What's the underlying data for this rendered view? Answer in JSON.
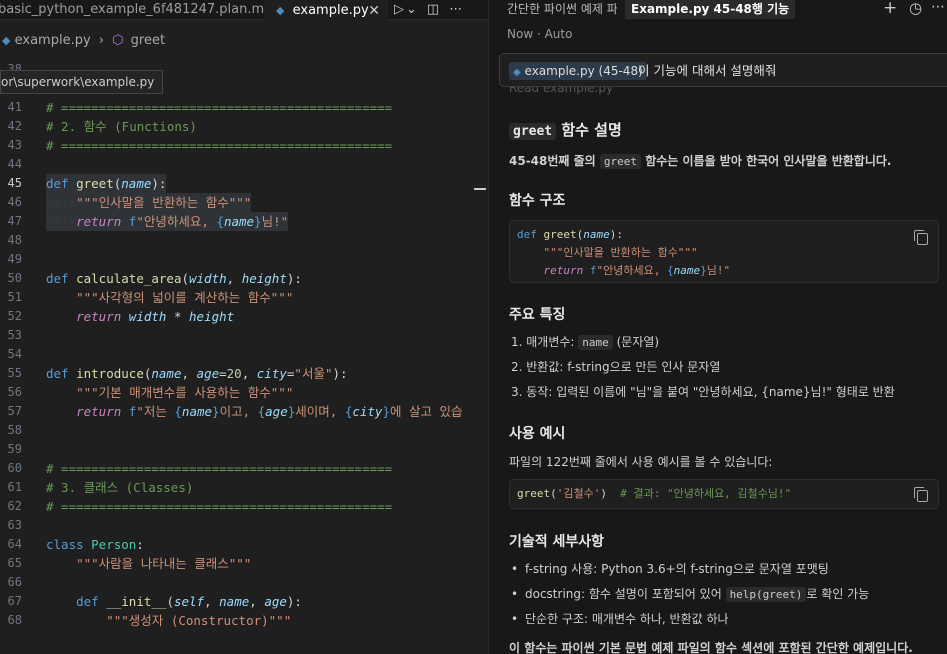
{
  "editor": {
    "tabs": [
      {
        "label": "basic_python_example_6f481247.plan.md",
        "active": false
      },
      {
        "label": "example.py",
        "active": true,
        "close": "✕"
      }
    ],
    "breadcrumb": {
      "file": "example.py",
      "symbol": "greet"
    },
    "path_tooltip": "or\\superwork\\example.py",
    "lines": [
      {
        "n": "38",
        "parts": []
      },
      {
        "n": "40",
        "parts": []
      },
      {
        "n": "41",
        "parts": [
          {
            "c": "cm",
            "t": "# ============================================"
          }
        ]
      },
      {
        "n": "42",
        "parts": [
          {
            "c": "cm",
            "t": "# 2. 함수 (Functions)"
          }
        ]
      },
      {
        "n": "43",
        "parts": [
          {
            "c": "cm",
            "t": "# ============================================"
          }
        ]
      },
      {
        "n": "44",
        "parts": []
      },
      {
        "n": "45",
        "active": true,
        "sel": true,
        "parts": [
          {
            "c": "kw",
            "t": "def "
          },
          {
            "c": "fn",
            "t": "greet"
          },
          {
            "c": "op",
            "t": "("
          },
          {
            "c": "pa",
            "t": "name"
          },
          {
            "c": "op",
            "t": "):"
          }
        ]
      },
      {
        "n": "46",
        "sel": true,
        "parts": [
          {
            "c": "dots",
            "t": "····"
          },
          {
            "c": "st",
            "t": "\"\"\"인사말을 반환하는 함수\"\"\""
          }
        ]
      },
      {
        "n": "47",
        "sel": true,
        "parts": [
          {
            "c": "dots",
            "t": "····"
          },
          {
            "c": "ctl",
            "t": "return "
          },
          {
            "c": "kw",
            "t": "f"
          },
          {
            "c": "st",
            "t": "\"안녕하세요, "
          },
          {
            "c": "kw",
            "t": "{"
          },
          {
            "c": "pa",
            "t": "name"
          },
          {
            "c": "kw",
            "t": "}"
          },
          {
            "c": "st",
            "t": "님!\""
          }
        ]
      },
      {
        "n": "48",
        "parts": []
      },
      {
        "n": "49",
        "parts": []
      },
      {
        "n": "50",
        "parts": [
          {
            "c": "kw",
            "t": "def "
          },
          {
            "c": "fn",
            "t": "calculate_area"
          },
          {
            "c": "op",
            "t": "("
          },
          {
            "c": "pa",
            "t": "width"
          },
          {
            "c": "op",
            "t": ", "
          },
          {
            "c": "pa",
            "t": "height"
          },
          {
            "c": "op",
            "t": "):"
          }
        ]
      },
      {
        "n": "51",
        "parts": [
          {
            "c": "op",
            "t": "    "
          },
          {
            "c": "st",
            "t": "\"\"\"사각형의 넓이를 계산하는 함수\"\"\""
          }
        ]
      },
      {
        "n": "52",
        "parts": [
          {
            "c": "op",
            "t": "    "
          },
          {
            "c": "ctl",
            "t": "return "
          },
          {
            "c": "pa",
            "t": "width"
          },
          {
            "c": "op",
            "t": " * "
          },
          {
            "c": "pa",
            "t": "height"
          }
        ]
      },
      {
        "n": "53",
        "parts": []
      },
      {
        "n": "54",
        "parts": []
      },
      {
        "n": "55",
        "parts": [
          {
            "c": "kw",
            "t": "def "
          },
          {
            "c": "fn",
            "t": "introduce"
          },
          {
            "c": "op",
            "t": "("
          },
          {
            "c": "pa",
            "t": "name"
          },
          {
            "c": "op",
            "t": ", "
          },
          {
            "c": "pa",
            "t": "age"
          },
          {
            "c": "op",
            "t": "="
          },
          {
            "c": "num",
            "t": "20"
          },
          {
            "c": "op",
            "t": ", "
          },
          {
            "c": "pa",
            "t": "city"
          },
          {
            "c": "op",
            "t": "="
          },
          {
            "c": "st",
            "t": "\"서울\""
          },
          {
            "c": "op",
            "t": "):"
          }
        ]
      },
      {
        "n": "56",
        "parts": [
          {
            "c": "op",
            "t": "    "
          },
          {
            "c": "st",
            "t": "\"\"\"기본 매개변수를 사용하는 함수\"\"\""
          }
        ]
      },
      {
        "n": "57",
        "parts": [
          {
            "c": "op",
            "t": "    "
          },
          {
            "c": "ctl",
            "t": "return "
          },
          {
            "c": "kw",
            "t": "f"
          },
          {
            "c": "st",
            "t": "\"저는 "
          },
          {
            "c": "kw",
            "t": "{"
          },
          {
            "c": "pa",
            "t": "name"
          },
          {
            "c": "kw",
            "t": "}"
          },
          {
            "c": "st",
            "t": "이고, "
          },
          {
            "c": "kw",
            "t": "{"
          },
          {
            "c": "pa",
            "t": "age"
          },
          {
            "c": "kw",
            "t": "}"
          },
          {
            "c": "st",
            "t": "세이며, "
          },
          {
            "c": "kw",
            "t": "{"
          },
          {
            "c": "pa",
            "t": "city"
          },
          {
            "c": "kw",
            "t": "}"
          },
          {
            "c": "st",
            "t": "에 살고 있습"
          }
        ]
      },
      {
        "n": "58",
        "parts": []
      },
      {
        "n": "59",
        "parts": []
      },
      {
        "n": "60",
        "parts": [
          {
            "c": "cm",
            "t": "# ============================================"
          }
        ]
      },
      {
        "n": "61",
        "parts": [
          {
            "c": "cm",
            "t": "# 3. 클래스 (Classes)"
          }
        ]
      },
      {
        "n": "62",
        "parts": [
          {
            "c": "cm",
            "t": "# ============================================"
          }
        ]
      },
      {
        "n": "63",
        "parts": []
      },
      {
        "n": "64",
        "parts": [
          {
            "c": "kw",
            "t": "class "
          },
          {
            "c": "cls",
            "t": "Person"
          },
          {
            "c": "op",
            "t": ":"
          }
        ]
      },
      {
        "n": "65",
        "parts": [
          {
            "c": "op",
            "t": "    "
          },
          {
            "c": "st",
            "t": "\"\"\"사람을 나타내는 클래스\"\"\""
          }
        ]
      },
      {
        "n": "66",
        "parts": []
      },
      {
        "n": "67",
        "parts": [
          {
            "c": "op",
            "t": "    "
          },
          {
            "c": "kw",
            "t": "def "
          },
          {
            "c": "fn",
            "t": "__init__"
          },
          {
            "c": "op",
            "t": "("
          },
          {
            "c": "pa",
            "t": "self"
          },
          {
            "c": "op",
            "t": ", "
          },
          {
            "c": "pa",
            "t": "name"
          },
          {
            "c": "op",
            "t": ", "
          },
          {
            "c": "pa",
            "t": "age"
          },
          {
            "c": "op",
            "t": "):"
          }
        ]
      },
      {
        "n": "68",
        "parts": [
          {
            "c": "op",
            "t": "        "
          },
          {
            "c": "st",
            "t": "\"\"\"생성자 (Constructor)\"\"\""
          }
        ]
      }
    ]
  },
  "chat": {
    "title_1": "간단한 파이썬 예제 파",
    "title_2": "Example.py 45-48행 기능",
    "meta": "Now · Auto",
    "user_chip": "example.py (45-48)",
    "user_text": "이 기능에 대해서 설명해줘",
    "read_ghost": "Read example.py",
    "heading_code": "greet",
    "heading_text": " 함수 설명",
    "intro_pre": "45-48번째 줄의 ",
    "intro_code": "greet",
    "intro_post": " 함수는 이름을 받아 한국어 인사말을 반환합니다.",
    "section_structure": "함수 구조",
    "structure_code": [
      [
        {
          "c": "kw",
          "t": "def "
        },
        {
          "c": "fn",
          "t": "greet"
        },
        {
          "c": "op",
          "t": "("
        },
        {
          "c": "pa",
          "t": "name"
        },
        {
          "c": "op",
          "t": "):"
        }
      ],
      [
        {
          "c": "op",
          "t": "    "
        },
        {
          "c": "st",
          "t": "\"\"\"인사말을 반환하는 함수\"\"\""
        }
      ],
      [
        {
          "c": "op",
          "t": "    "
        },
        {
          "c": "ctl",
          "t": "return "
        },
        {
          "c": "kw",
          "t": "f"
        },
        {
          "c": "st",
          "t": "\"안녕하세요, "
        },
        {
          "c": "kw",
          "t": "{"
        },
        {
          "c": "pa",
          "t": "name"
        },
        {
          "c": "kw",
          "t": "}"
        },
        {
          "c": "st",
          "t": "님!\""
        }
      ]
    ],
    "section_features": "주요 특징",
    "features": [
      {
        "pre": "1. 매개변수: ",
        "code": "name",
        "post": " (문자열)"
      },
      {
        "pre": "2. 반환값: f-string으로 만든 인사 문자열",
        "code": "",
        "post": ""
      },
      {
        "pre": "3. 동작: 입력된 이름에 \"님\"을 붙여 \"안녕하세요, {name}님!\" 형태로 반환",
        "code": "",
        "post": ""
      }
    ],
    "section_usage": "사용 예시",
    "usage_text": "파일의 122번째 줄에서 사용 예시를 볼 수 있습니다:",
    "usage_code": [
      [
        {
          "c": "fn",
          "t": "greet"
        },
        {
          "c": "op",
          "t": "("
        },
        {
          "c": "st",
          "t": "'김철수'"
        },
        {
          "c": "op",
          "t": ")  "
        },
        {
          "c": "cm",
          "t": "# 결과: \"안녕하세요, 김철수님!\""
        }
      ]
    ],
    "section_details": "기술적 세부사항",
    "details": [
      {
        "pre": "f-string 사용: Python 3.6+의 f-string으로 문자열 포맷팅",
        "code": "",
        "post": ""
      },
      {
        "pre": "docstring: 함수 설명이 포함되어 있어 ",
        "code": "help(greet)",
        "post": "로 확인 가능"
      },
      {
        "pre": "단순한 구조: 매개변수 하나, 반환값 하나",
        "code": "",
        "post": ""
      }
    ],
    "footer_text": "이 함수는 파이썬 기본 문법 예제 파일의 함수 섹션에 포함된 간단한 예제입니다."
  },
  "icons": {
    "run": "▷",
    "chevron": "⌄",
    "split": "◫",
    "more": "⋯",
    "plus": "+",
    "history": "🕘",
    "cube": "⬡",
    "python": "●"
  }
}
